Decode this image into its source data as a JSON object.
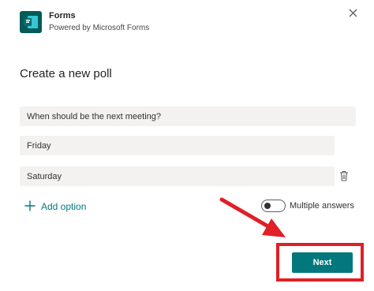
{
  "header": {
    "app_name": "Forms",
    "app_subtitle": "Powered by Microsoft Forms",
    "logo_icon": "forms-logo-icon",
    "close_icon": "close-icon"
  },
  "main": {
    "title": "Create a new poll",
    "question": {
      "value": "When should be the next meeting?"
    },
    "options": [
      {
        "value": "Friday"
      },
      {
        "value": "Saturday"
      }
    ],
    "delete_icon": "trash-icon",
    "add_option_label": "Add option",
    "multiple_answers": {
      "label": "Multiple answers",
      "enabled": false
    }
  },
  "footer": {
    "next_label": "Next"
  },
  "colors": {
    "accent": "#03787c",
    "logo_bg": "#035a59",
    "annotation": "#e01f26",
    "field_bg": "#f3f2f1"
  }
}
